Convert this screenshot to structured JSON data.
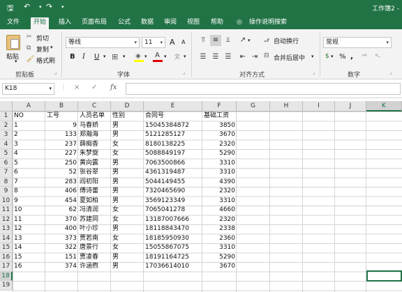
{
  "title_bar": {
    "undo_glyph": "↶",
    "redo_glyph": "↷",
    "save_glyph": "🖫",
    "window_title": "工作簿2 -"
  },
  "tabs": [
    "文件",
    "开始",
    "插入",
    "页面布局",
    "公式",
    "数据",
    "审阅",
    "视图",
    "帮助",
    "操作说明搜索"
  ],
  "active_tab": "开始",
  "ribbon": {
    "paste": "粘贴",
    "cut": "剪切",
    "copy": "复制",
    "format_painter": "格式刷",
    "clipboard_group": "剪贴板",
    "font_name": "等线",
    "font_size": "11",
    "bold": "B",
    "italic": "I",
    "underline": "U",
    "font_color_glyph": "A",
    "font_group": "字体",
    "wrap_text": "自动换行",
    "merge_center": "合并后居中",
    "alignment_group": "对齐方式",
    "number_format": "常规",
    "percent_glyph": "%",
    "comma_glyph": ",",
    "number_group": "数字",
    "grow_font": "A",
    "shrink_font": "A"
  },
  "formula_bar": {
    "name_box": "K18",
    "fx": "fx",
    "cancel": "×",
    "enter": "✓",
    "formula": ""
  },
  "columns": [
    "A",
    "B",
    "C",
    "D",
    "E",
    "F",
    "G",
    "H",
    "I",
    "J",
    "K"
  ],
  "selected_column": "K",
  "row_numbers": [
    "1",
    "2",
    "3",
    "4",
    "5",
    "6",
    "7",
    "8",
    "9",
    "10",
    "11",
    "12",
    "13",
    "14",
    "15",
    "16",
    "17",
    "18",
    "19"
  ],
  "selected_row": "18",
  "headers": [
    "NO",
    "工号",
    "人员名单",
    "性别",
    "合同号",
    "基础工资"
  ],
  "rows": [
    [
      "1",
      "9",
      "马春娇",
      "男",
      "15045384872",
      "3850"
    ],
    [
      "2",
      "133",
      "郑瀚海",
      "男",
      "5121285127",
      "3670"
    ],
    [
      "3",
      "237",
      "薛痴香",
      "女",
      "8180138225",
      "2320"
    ],
    [
      "4",
      "227",
      "朱梦旋",
      "女",
      "5088849197",
      "5290"
    ],
    [
      "5",
      "250",
      "黄向露",
      "男",
      "7063500866",
      "3310"
    ],
    [
      "6",
      "52",
      "张谷翠",
      "男",
      "4361319487",
      "3310"
    ],
    [
      "7",
      "283",
      "阎初阳",
      "男",
      "5044149455",
      "4390"
    ],
    [
      "8",
      "406",
      "傅诗蕾",
      "男",
      "7320465690",
      "2320"
    ],
    [
      "9",
      "454",
      "夏如柏",
      "男",
      "3569123349",
      "3310"
    ],
    [
      "10",
      "62",
      "冯清润",
      "女",
      "7065041278",
      "4660"
    ],
    [
      "11",
      "370",
      "苏建同",
      "女",
      "13187007666",
      "2320"
    ],
    [
      "12",
      "400",
      "叶小珍",
      "男",
      "18118843470",
      "2338"
    ],
    [
      "13",
      "373",
      "贾若南",
      "女",
      "18185950930",
      "2360"
    ],
    [
      "14",
      "322",
      "唐景行",
      "女",
      "15055867075",
      "3310"
    ],
    [
      "15",
      "151",
      "贾凌春",
      "男",
      "18191164725",
      "5290"
    ],
    [
      "16",
      "374",
      "许涵煦",
      "男",
      "17036614010",
      "3670"
    ]
  ],
  "colors": {
    "accent": "#217346",
    "gridline": "#d4d4d4",
    "header_bg": "#e6e6e6"
  }
}
